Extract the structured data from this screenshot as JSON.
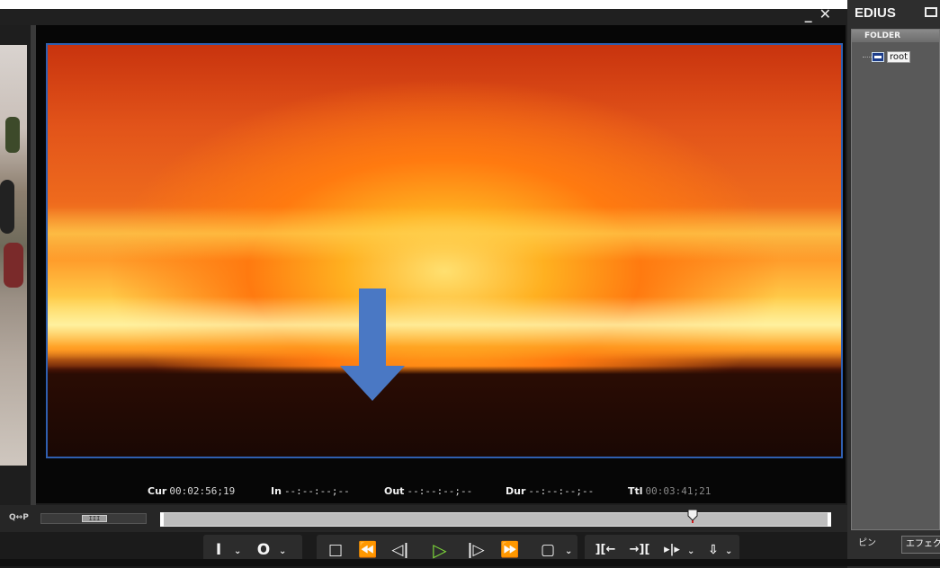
{
  "window": {
    "minimize_icon": "minimize-icon",
    "close_icon": "close-icon"
  },
  "timecodes": {
    "cur_label": "Cur",
    "cur_value": "00:02:56;19",
    "in_label": "In",
    "in_value": "--:--:--;--",
    "out_label": "Out",
    "out_value": "--:--:--;--",
    "dur_label": "Dur",
    "dur_value": "--:--:--;--",
    "ttl_label": "Ttl",
    "ttl_value": "00:03:41;21"
  },
  "scrub": {
    "zoom_label": "Q↔P",
    "zoom_thumb": "III",
    "position_fraction": 0.795
  },
  "transport": {
    "set_in": "I",
    "set_out": "O",
    "stop": "□",
    "rewind": "⏪",
    "step_back": "◁|",
    "play": "▷",
    "step_forward": "|▷",
    "fast_forward": "⏩",
    "loop": "▢",
    "insert": "][←",
    "overwrite": "→][",
    "ripple": "▸|▸",
    "export": "⇩"
  },
  "bin": {
    "title": "EDIUS",
    "folder_header": "FOLDER",
    "root_label": "root",
    "tab_1": "ピン",
    "tab_2": "エフェクト"
  },
  "colors": {
    "video_border": "#2f5fb0",
    "arrow": "#4a78c4",
    "play_green": "#7fdc3a"
  }
}
